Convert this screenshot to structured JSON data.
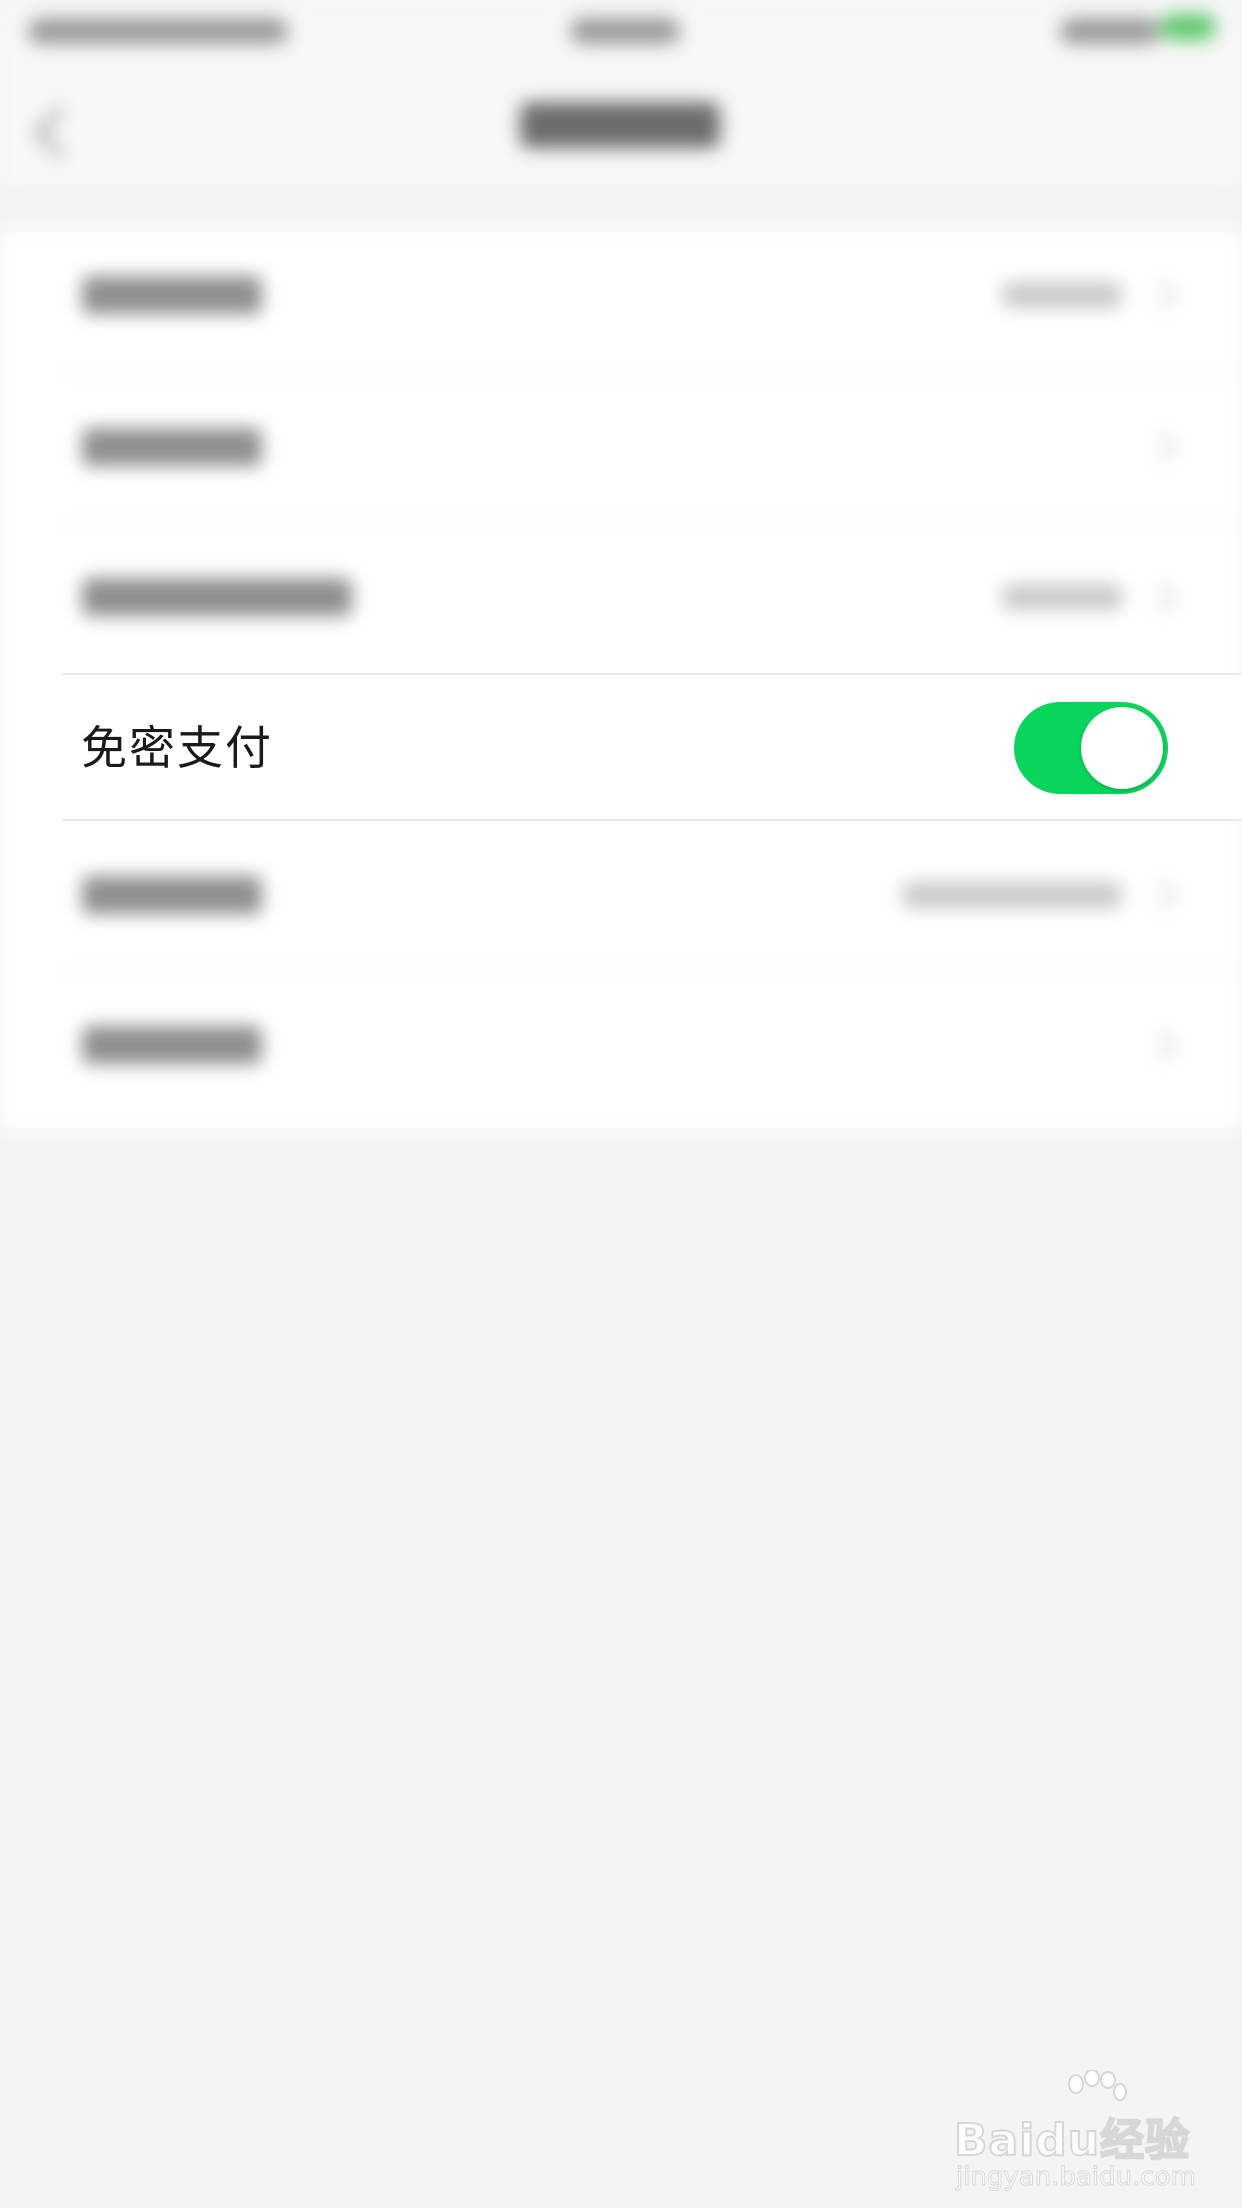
{
  "focused_setting": {
    "label": "免密支付",
    "toggle_on": true,
    "toggle_color": "#09d55c"
  },
  "watermark": {
    "brand": "Baidu经验",
    "url": "jingyan.baidu.com"
  }
}
